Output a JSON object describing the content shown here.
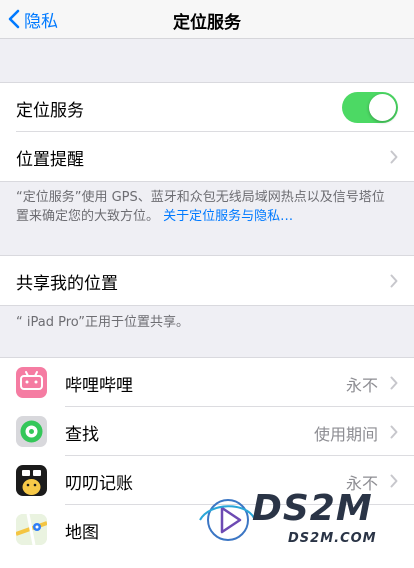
{
  "nav": {
    "back_label": "隐私",
    "title": "定位服务"
  },
  "location_group": {
    "location_services_label": "定位服务",
    "location_services_on": true,
    "location_alerts_label": "位置提醒"
  },
  "location_footer": {
    "text": "“定位服务”使用 GPS、蓝牙和众包无线局域网热点以及信号塔位置来确定您的大致方位。",
    "link": "关于定位服务与隐私…"
  },
  "share_group": {
    "share_label": "共享我的位置"
  },
  "share_footer": {
    "text": "“      iPad Pro”正用于位置共享。"
  },
  "apps": [
    {
      "name": "哔哩哔哩",
      "value": "永不",
      "icon": "bilibili-icon",
      "color": "#f57ca2"
    },
    {
      "name": "查找",
      "value": "使用期间",
      "icon": "find-my-icon",
      "color": "#34c759"
    },
    {
      "name": "叨叨记账",
      "value": "永不",
      "icon": "daodao-icon",
      "color": "#1b1b1b"
    },
    {
      "name": "地图",
      "value": "",
      "icon": "maps-icon",
      "color": "#e8f0e2"
    }
  ],
  "watermark": {
    "logo": "DS2M",
    "site": "DS2M.COM"
  },
  "colors": {
    "accent": "#007aff",
    "switch_on": "#4cd964",
    "background": "#efeff4"
  }
}
